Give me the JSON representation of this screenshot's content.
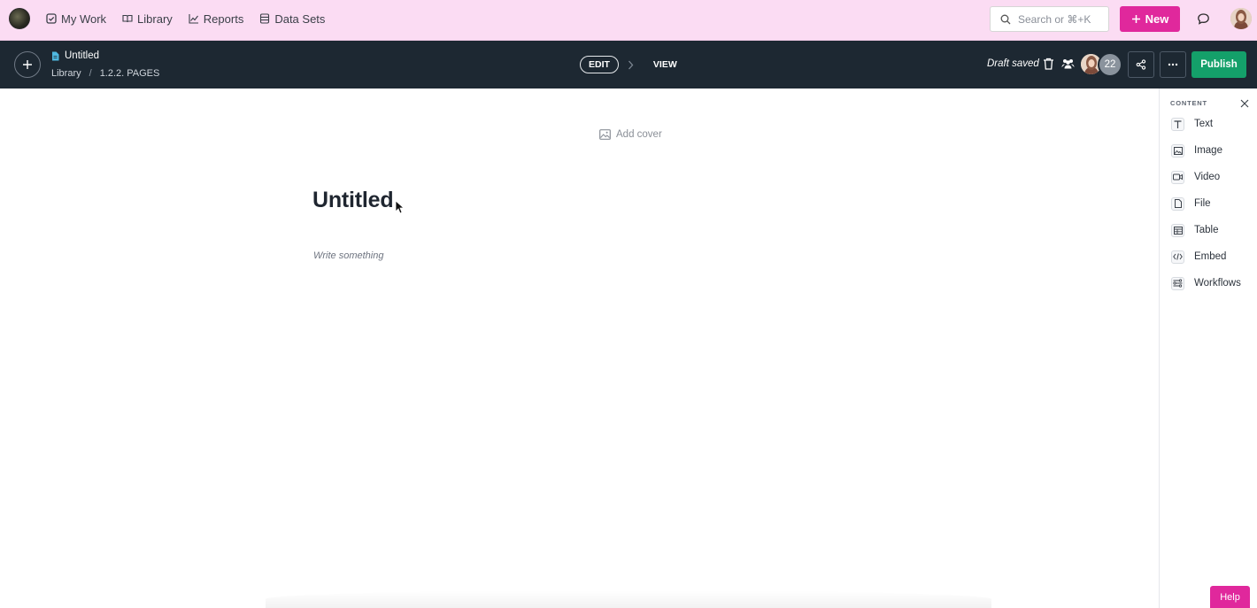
{
  "topnav": {
    "links": [
      "My Work",
      "Library",
      "Reports",
      "Data Sets"
    ],
    "search_placeholder": "Search or ⌘+K",
    "new_label": "New"
  },
  "editbar": {
    "doc_title": "Untitled",
    "breadcrumb": [
      "Library",
      "1.2.2. PAGES"
    ],
    "mode_edit": "EDIT",
    "mode_view": "VIEW",
    "status": "Draft saved",
    "collaborator_count": "22",
    "publish_label": "Publish"
  },
  "canvas": {
    "add_cover_label": "Add cover",
    "title": "Untitled",
    "placeholder": "Write something"
  },
  "panel": {
    "heading": "CONTENT",
    "items": [
      {
        "label": "Text",
        "icon": "text-icon"
      },
      {
        "label": "Image",
        "icon": "image-icon"
      },
      {
        "label": "Video",
        "icon": "video-icon"
      },
      {
        "label": "File",
        "icon": "file-icon"
      },
      {
        "label": "Table",
        "icon": "table-icon"
      },
      {
        "label": "Embed",
        "icon": "embed-icon"
      },
      {
        "label": "Workflows",
        "icon": "workflows-icon"
      }
    ]
  },
  "help_label": "Help",
  "colors": {
    "brand_pink": "#e0289c",
    "topnav_bg": "#fbdcf3",
    "editbar_bg": "#1d2832",
    "publish_green": "#14a06a"
  }
}
